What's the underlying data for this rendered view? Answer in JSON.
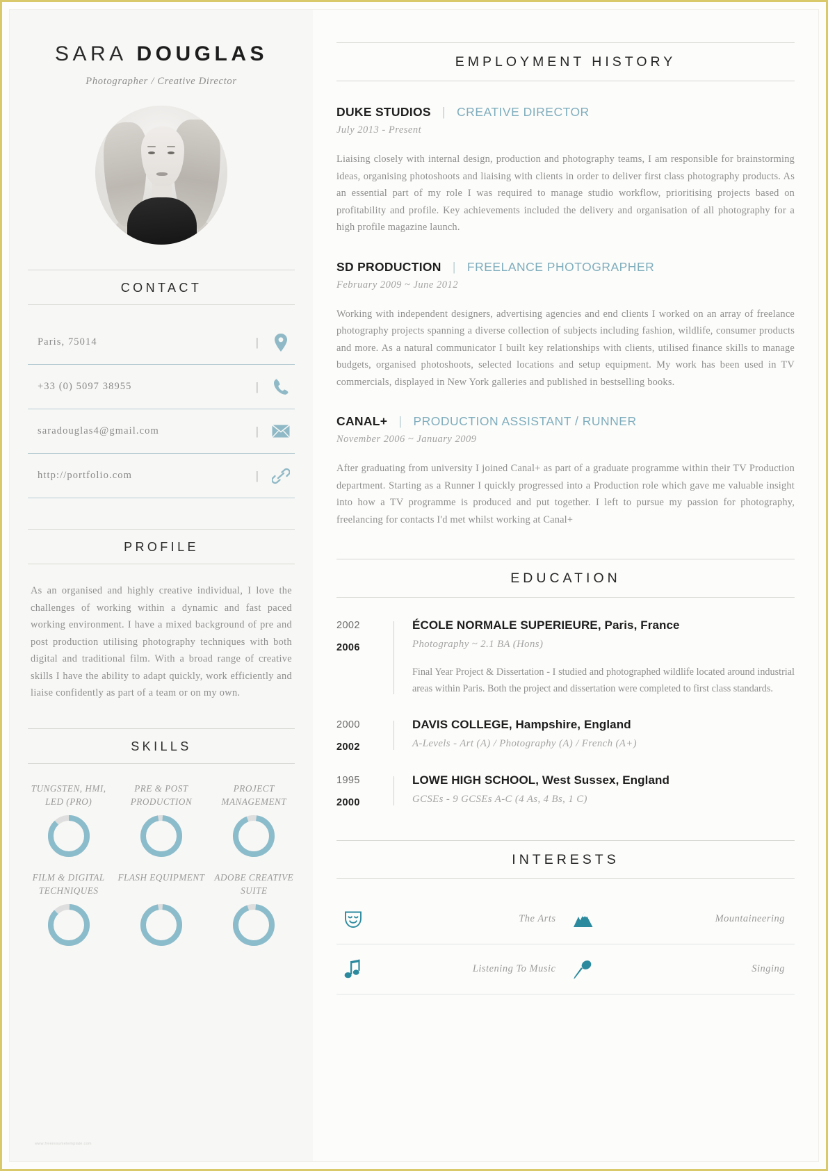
{
  "theme": {
    "frame_color": "#d9c96b",
    "accent_teal": "#7fadbd",
    "icon_teal": "#8fb9c6",
    "interest_icon_teal": "#2b8a9e",
    "donut_fill": "#8bbccb",
    "donut_track": "#dedede",
    "heading_color": "#262626",
    "body_color": "#8e8e8e"
  },
  "header": {
    "first_name": "SARA",
    "last_name": "DOUGLAS",
    "subtitle": "Photographer / Creative Director",
    "photo_alt": "portrait-photo"
  },
  "contact": {
    "heading": "CONTACT",
    "separator": "|",
    "items": [
      {
        "text": "Paris, 75014",
        "icon": "location-pin-icon"
      },
      {
        "text": "+33 (0) 5097 38955",
        "icon": "phone-icon"
      },
      {
        "text": "saradouglas4@gmail.com",
        "icon": "envelope-icon"
      },
      {
        "text": "http://portfolio.com",
        "icon": "link-icon"
      }
    ]
  },
  "profile": {
    "heading": "PROFILE",
    "body": "As an organised and highly creative individual, I love the challenges of working within a dynamic and fast paced working environment. I have a mixed background of pre and post production utilising photography techniques with both digital and traditional film. With a broad range of creative skills I have the ability to adapt quickly, work efficiently and liaise confidently as part of a team or on my own."
  },
  "skills": {
    "heading": "SKILLS",
    "chart_data": {
      "type": "pie",
      "title": "Skills",
      "categories": [
        "TUNGSTEN, HMI, LED (PRO)",
        "PRE & POST PRODUCTION",
        "PROJECT MANAGEMENT",
        "FILM & DIGITAL TECHNIQUES",
        "FLASH EQUIPMENT",
        "ADOBE CREATIVE SUITE"
      ],
      "values": [
        88,
        96,
        92,
        87,
        96,
        93
      ],
      "unit": "%",
      "ylim": [
        0,
        100
      ]
    },
    "items": [
      {
        "label": "TUNGSTEN, HMI, LED (PRO)",
        "percent": 88
      },
      {
        "label": "PRE & POST PRODUCTION",
        "percent": 96
      },
      {
        "label": "PROJECT MANAGEMENT",
        "percent": 92
      },
      {
        "label": "FILM & DIGITAL TECHNIQUES",
        "percent": 87
      },
      {
        "label": "FLASH EQUIPMENT",
        "percent": 96
      },
      {
        "label": "ADOBE CREATIVE SUITE",
        "percent": 93
      }
    ]
  },
  "employment": {
    "heading": "EMPLOYMENT HISTORY",
    "separator": "|",
    "jobs": [
      {
        "company": "DUKE STUDIOS",
        "role": "CREATIVE DIRECTOR",
        "dates": "July 2013 - Present",
        "description": "Liaising closely with internal design, production and photography teams, I am responsible for brainstorming ideas, organising photoshoots and liaising with clients in order to deliver first class photography products.   As an essential part of my role I was required to manage studio workflow, prioritising projects based on profitability and profile.  Key achievements included the delivery and organisation of all photography for a high profile magazine launch."
      },
      {
        "company": "SD PRODUCTION",
        "role": "FREELANCE PHOTOGRAPHER",
        "dates": "February 2009 ~ June 2012",
        "description": "Working with independent designers, advertising agencies and end clients I worked on an array of freelance photography projects spanning a diverse collection of subjects including fashion, wildlife, consumer products and more.  As a natural communicator I built key relationships with clients, utilised finance skills to manage budgets, organised photoshoots, selected locations and setup equipment.   My work has been used in TV commercials, displayed in New York galleries and published in bestselling books."
      },
      {
        "company": "CANAL+",
        "role": "PRODUCTION ASSISTANT / RUNNER",
        "dates": "November 2006 ~ January 2009",
        "description": "After graduating from university I joined Canal+ as part of a graduate programme within their TV Production department.  Starting as a Runner I quickly progressed into a Production role which gave me valuable insight into how a TV programme is produced and put together. I left to pursue my passion for photography, freelancing for contacts I'd met whilst working at Canal+"
      }
    ]
  },
  "education": {
    "heading": "EDUCATION",
    "items": [
      {
        "year_start": "2002",
        "year_end": "2006",
        "school": "ÉCOLE NORMALE SUPERIEURE",
        "location": ", Paris, France",
        "qualification": "Photography ~ 2.1 BA (Hons)",
        "note": "Final Year Project & Dissertation - I studied and photographed wildlife located around industrial areas within Paris. Both the project and dissertation were completed to first class standards."
      },
      {
        "year_start": "2000",
        "year_end": "2002",
        "school": "DAVIS COLLEGE",
        "location": ", Hampshire, England",
        "qualification": "A-Levels - Art (A) / Photography (A) / French (A+)",
        "note": ""
      },
      {
        "year_start": "1995",
        "year_end": "2000",
        "school": "LOWE HIGH SCHOOL",
        "location": ", West Sussex, England",
        "qualification": "GCSEs - 9 GCSEs A-C (4 As, 4 Bs, 1 C)",
        "note": ""
      }
    ]
  },
  "interests": {
    "heading": "INTERESTS",
    "items": [
      {
        "label": "The Arts",
        "icon": "theatre-mask-icon"
      },
      {
        "label": "Mountaineering",
        "icon": "mountain-icon"
      },
      {
        "label": "Listening To Music",
        "icon": "music-notes-icon"
      },
      {
        "label": "Singing",
        "icon": "microphone-icon"
      }
    ]
  },
  "watermark": {
    "text": "www.freeresumetemplate.com"
  }
}
